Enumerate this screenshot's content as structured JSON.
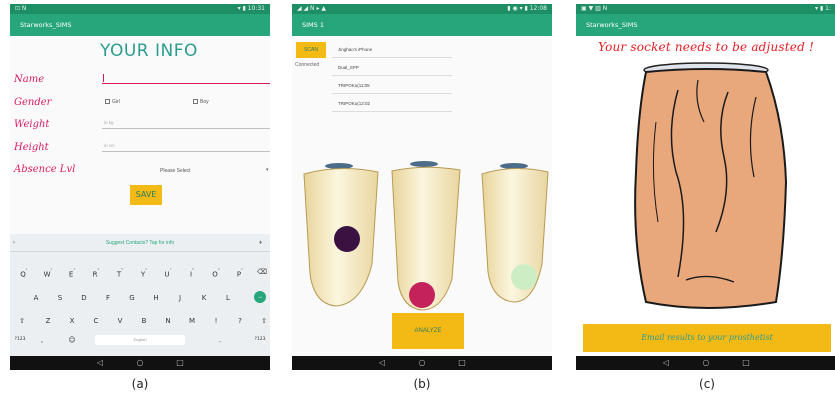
{
  "colors": {
    "status_bar": "#1e8e64",
    "app_bar": "#26a67a",
    "accent_button": "#f3b915",
    "label_pink": "#d81b60",
    "warning_red": "#e51c23"
  },
  "panel_a": {
    "status_left": "⊡ N",
    "status_right": "▾ ▮ 10:31",
    "app_title": "Starworks_SIMS",
    "page_title": "YOUR INFO",
    "name_label": "Name",
    "gender_label": "Gender",
    "girl_label": "Girl",
    "boy_label": "Boy",
    "weight_label": "Weight",
    "weight_placeholder": "in kg",
    "height_label": "Height",
    "height_placeholder": "in cm",
    "absence_label": "Absence Lvl",
    "absence_select": "Please Select",
    "save_label": "SAVE",
    "keyboard": {
      "suggestion": "Suggest Contacts? Tap for info",
      "row1": [
        "Q",
        "W",
        "E",
        "R",
        "T",
        "Y",
        "U",
        "I",
        "O",
        "P"
      ],
      "row1_nums": [
        "1",
        "2",
        "3",
        "4",
        "5",
        "6",
        "7",
        "8",
        "9",
        "0"
      ],
      "row2": [
        "A",
        "S",
        "D",
        "F",
        "G",
        "H",
        "J",
        "K",
        "L"
      ],
      "row3": [
        "Z",
        "X",
        "C",
        "V",
        "B",
        "N",
        "M",
        "!",
        "?"
      ],
      "sym": "?123",
      "space": "English",
      "sym_right": "?123"
    },
    "caption": "(a)"
  },
  "panel_b": {
    "status_left": "◢ ◢ N ▸ ▲",
    "status_right": "▮ ◉ ▾ ▮ 12:08",
    "app_title": "SIMS 1",
    "scan_label": "SCAN",
    "connected_label": "Connected",
    "devices": [
      "Jinghao's iPhone",
      "Dual_SPP",
      "TRIPOKu(11:05",
      "TRIPOKu(12:02"
    ],
    "analyze_label": "ANALYZE",
    "caption": "(b)"
  },
  "panel_c": {
    "status_left": "▣ ▼ ▥ N",
    "status_right": "▾ ▮ 1:",
    "app_title": "Starworks_SIMS",
    "warning": "Your socket needs to be adjusted !",
    "email_label": "Email results to your prosthetist",
    "caption": "(c)"
  },
  "nav": {
    "back": "◁",
    "home": "○",
    "recents": "□"
  }
}
